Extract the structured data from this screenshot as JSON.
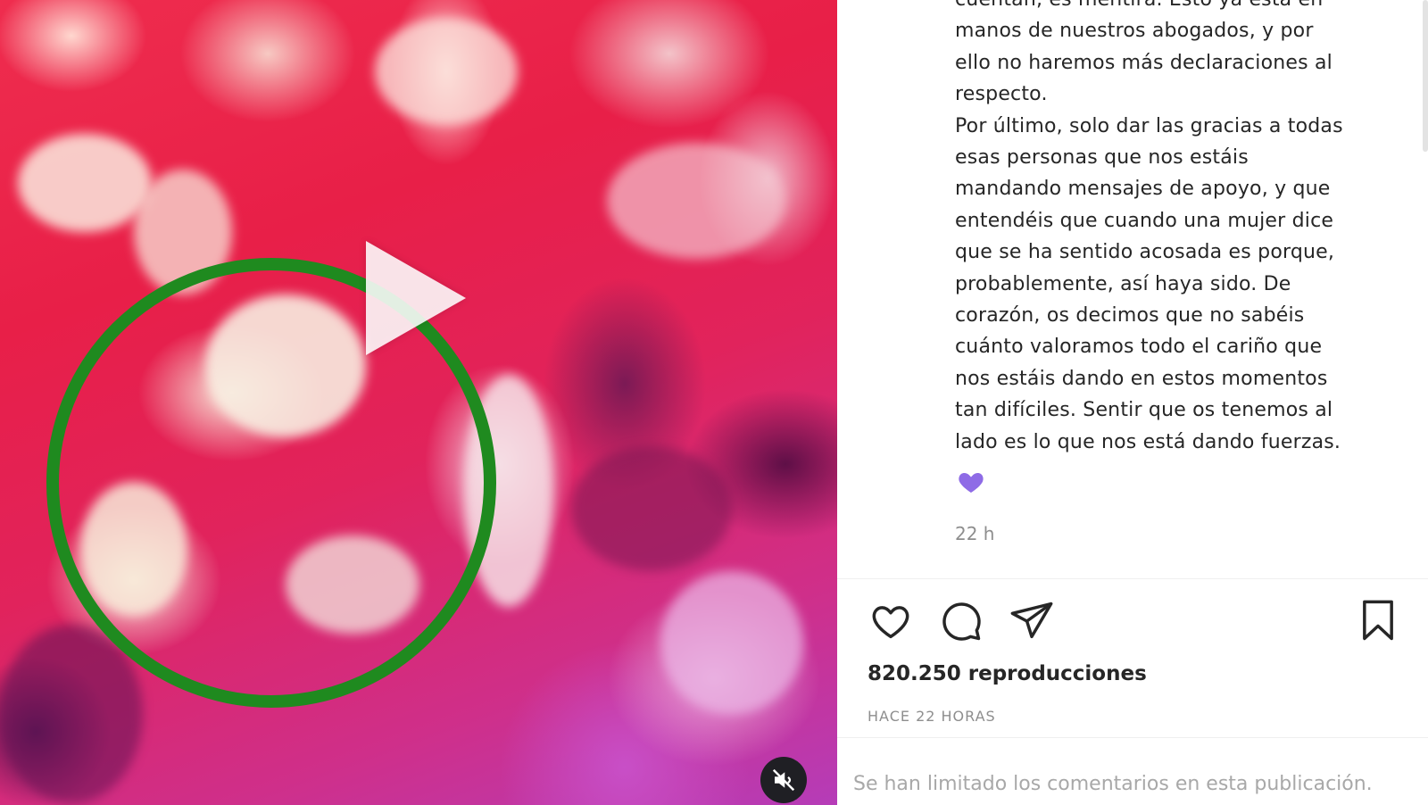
{
  "video": {
    "play_icon": "play-icon",
    "mute_icon": "speaker-muted-icon",
    "highlight_color": "#1f8a1f"
  },
  "post": {
    "caption": "cuentan, es mentira. Esto ya está en\nmanos de nuestros abogados, y por\nello no haremos más declaraciones al\nrespecto.\nPor último, solo dar las gracias a todas\nesas personas que nos estáis\nmandando mensajes de apoyo, y que\nentendéis que cuando una mujer dice\nque se ha sentido acosada es porque,\nprobablemente, así haya sido. De\ncorazón, os decimos que no sabéis\ncuánto valoramos todo el cariño que\nnos estáis dando en estos momentos\ntan difíciles. Sentir que os tenemos al\nlado es lo que nos está dando fuerzas.",
    "caption_emoji": "purple-heart-icon",
    "age": "22 h",
    "views": "820.250 reproducciones",
    "timestamp": "HACE 22 HORAS",
    "comments_notice": "Se han limitado los comentarios en esta publicación."
  },
  "actions": {
    "like_icon": "heart-icon",
    "comment_icon": "comment-icon",
    "share_icon": "paper-plane-icon",
    "save_icon": "bookmark-icon"
  },
  "colors": {
    "text": "#262626",
    "muted": "#8e8e8e",
    "highlight_ring": "#1f8a1f",
    "emoji_heart": "#8e6be6"
  }
}
